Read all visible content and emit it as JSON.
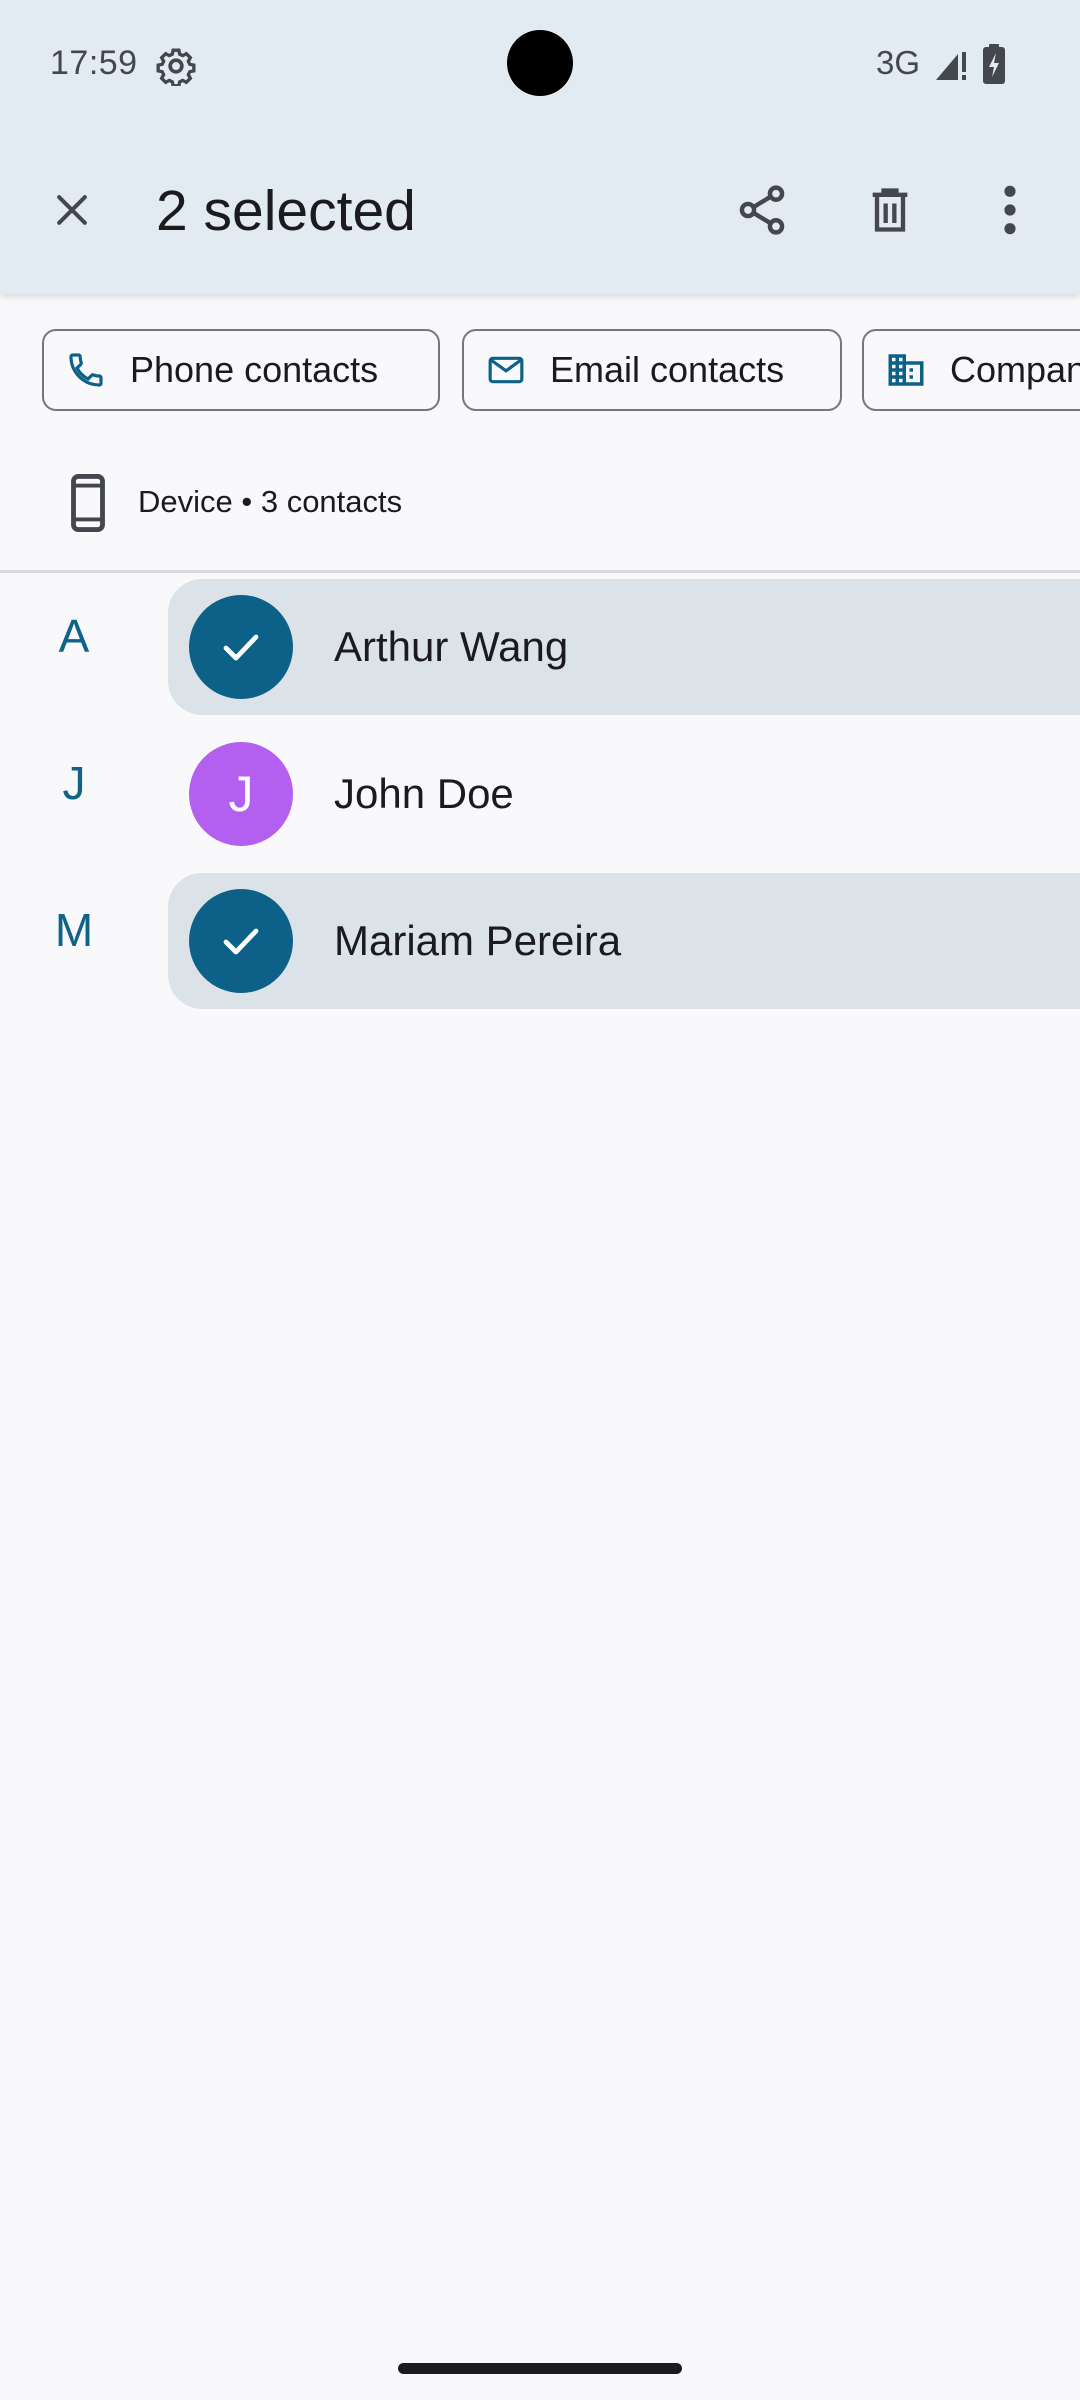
{
  "status_bar": {
    "time": "17:59",
    "network": "3G",
    "icons": [
      "settings-gear-icon",
      "signal-icon",
      "battery-charging-icon"
    ]
  },
  "app_bar": {
    "title": "2 selected",
    "actions": [
      "close-icon",
      "share-icon",
      "delete-icon",
      "more-vert-icon"
    ]
  },
  "filter_chips": [
    {
      "label": "Phone contacts",
      "icon": "phone-icon"
    },
    {
      "label": "Email contacts",
      "icon": "email-icon"
    },
    {
      "label": "Compan",
      "icon": "business-icon"
    }
  ],
  "account": {
    "label": "Device • 3 contacts",
    "icon": "smartphone-icon"
  },
  "contacts": [
    {
      "section": "A",
      "name": "Arthur Wang",
      "selected": true,
      "avatar": "check"
    },
    {
      "section": "J",
      "name": "John Doe",
      "selected": false,
      "avatar": "J"
    },
    {
      "section": "M",
      "name": "Mariam Pereira",
      "selected": true,
      "avatar": "check"
    }
  ],
  "colors": {
    "app_bar_bg": "#e1ebf1",
    "page_bg": "#f9f9fc",
    "accent": "#0d6188",
    "selected_row_bg": "#dbe3e8",
    "avatar_j": "#b35ff0",
    "section_letter": "#0f6389"
  }
}
